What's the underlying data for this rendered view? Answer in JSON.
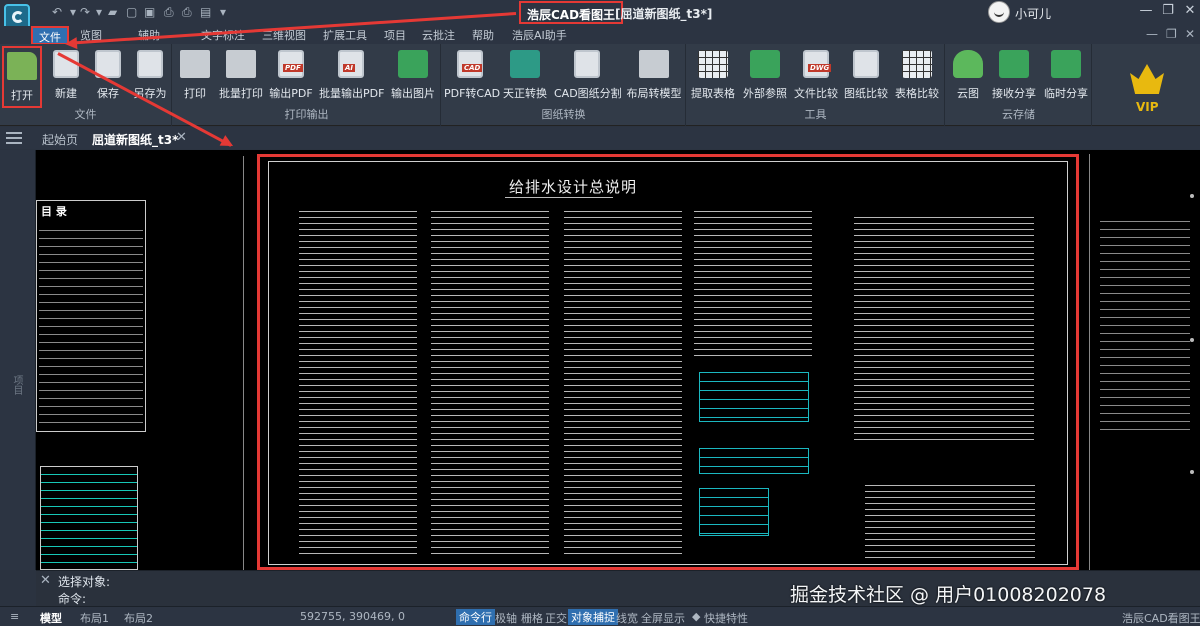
{
  "app": {
    "title": "浩辰CAD看图王",
    "document_title": "[屈道新图纸_t3*]",
    "user": "小可儿"
  },
  "window_controls": {
    "minimize": "—",
    "restore": "❐",
    "close": "✕"
  },
  "menu": [
    "文件",
    "览图",
    "辅助",
    "文字标注",
    "三维视图",
    "扩展工具",
    "项目",
    "云批注",
    "帮助",
    "浩辰AI助手"
  ],
  "ribbon": {
    "groups": [
      {
        "title": "文件",
        "buttons": [
          "打开",
          "新建",
          "保存",
          "另存为"
        ]
      },
      {
        "title": "打印输出",
        "buttons": [
          "打印",
          "批量打印",
          "输出PDF",
          "批量输出PDF",
          "输出图片"
        ]
      },
      {
        "title": "图纸转换",
        "buttons": [
          "PDF转CAD",
          "天正转换",
          "CAD图纸分割",
          "布局转模型"
        ]
      },
      {
        "title": "工具",
        "buttons": [
          "提取表格",
          "外部参照",
          "文件比较",
          "图纸比较",
          "表格比较"
        ]
      },
      {
        "title": "云存储",
        "buttons": [
          "云图",
          "接收分享",
          "临时分享"
        ]
      }
    ],
    "vip": "VIP",
    "icon_badges": {
      "pdf": "PDF",
      "dwg": "DWG",
      "cad": "CAD",
      "ai": "AI"
    }
  },
  "tabs": {
    "home": "起始页",
    "current": "屈道新图纸_t3*",
    "close": "✕"
  },
  "left_panel": {
    "label": "项目"
  },
  "canvas": {
    "sheet_title": "给排水设计总说明",
    "catalog_title": "目 录"
  },
  "command": {
    "history": "选择对象:",
    "prompt": "命令:",
    "close": "✕"
  },
  "status": {
    "layouts": [
      "模型",
      "布局1",
      "布局2"
    ],
    "coordinates": "592755, 390469, 0",
    "toggles": [
      {
        "label": "命令行",
        "on": true
      },
      {
        "label": "极轴",
        "on": false
      },
      {
        "label": "栅格",
        "on": false
      },
      {
        "label": "正交",
        "on": false
      },
      {
        "label": "对象捕捉",
        "on": true
      },
      {
        "label": "线宽",
        "on": false
      },
      {
        "label": "全屏显示",
        "on": false
      },
      {
        "label": "快捷特性",
        "on": false
      }
    ],
    "app_name": "浩辰CAD看图王"
  },
  "watermark": "掘金技术社区 @ 用户01008202078",
  "colors": {
    "highlight_box": "#e53935",
    "menu_active": "#2f6fb0",
    "vip": "#e8b90f",
    "cad_cyan": "#1bb8c0"
  }
}
